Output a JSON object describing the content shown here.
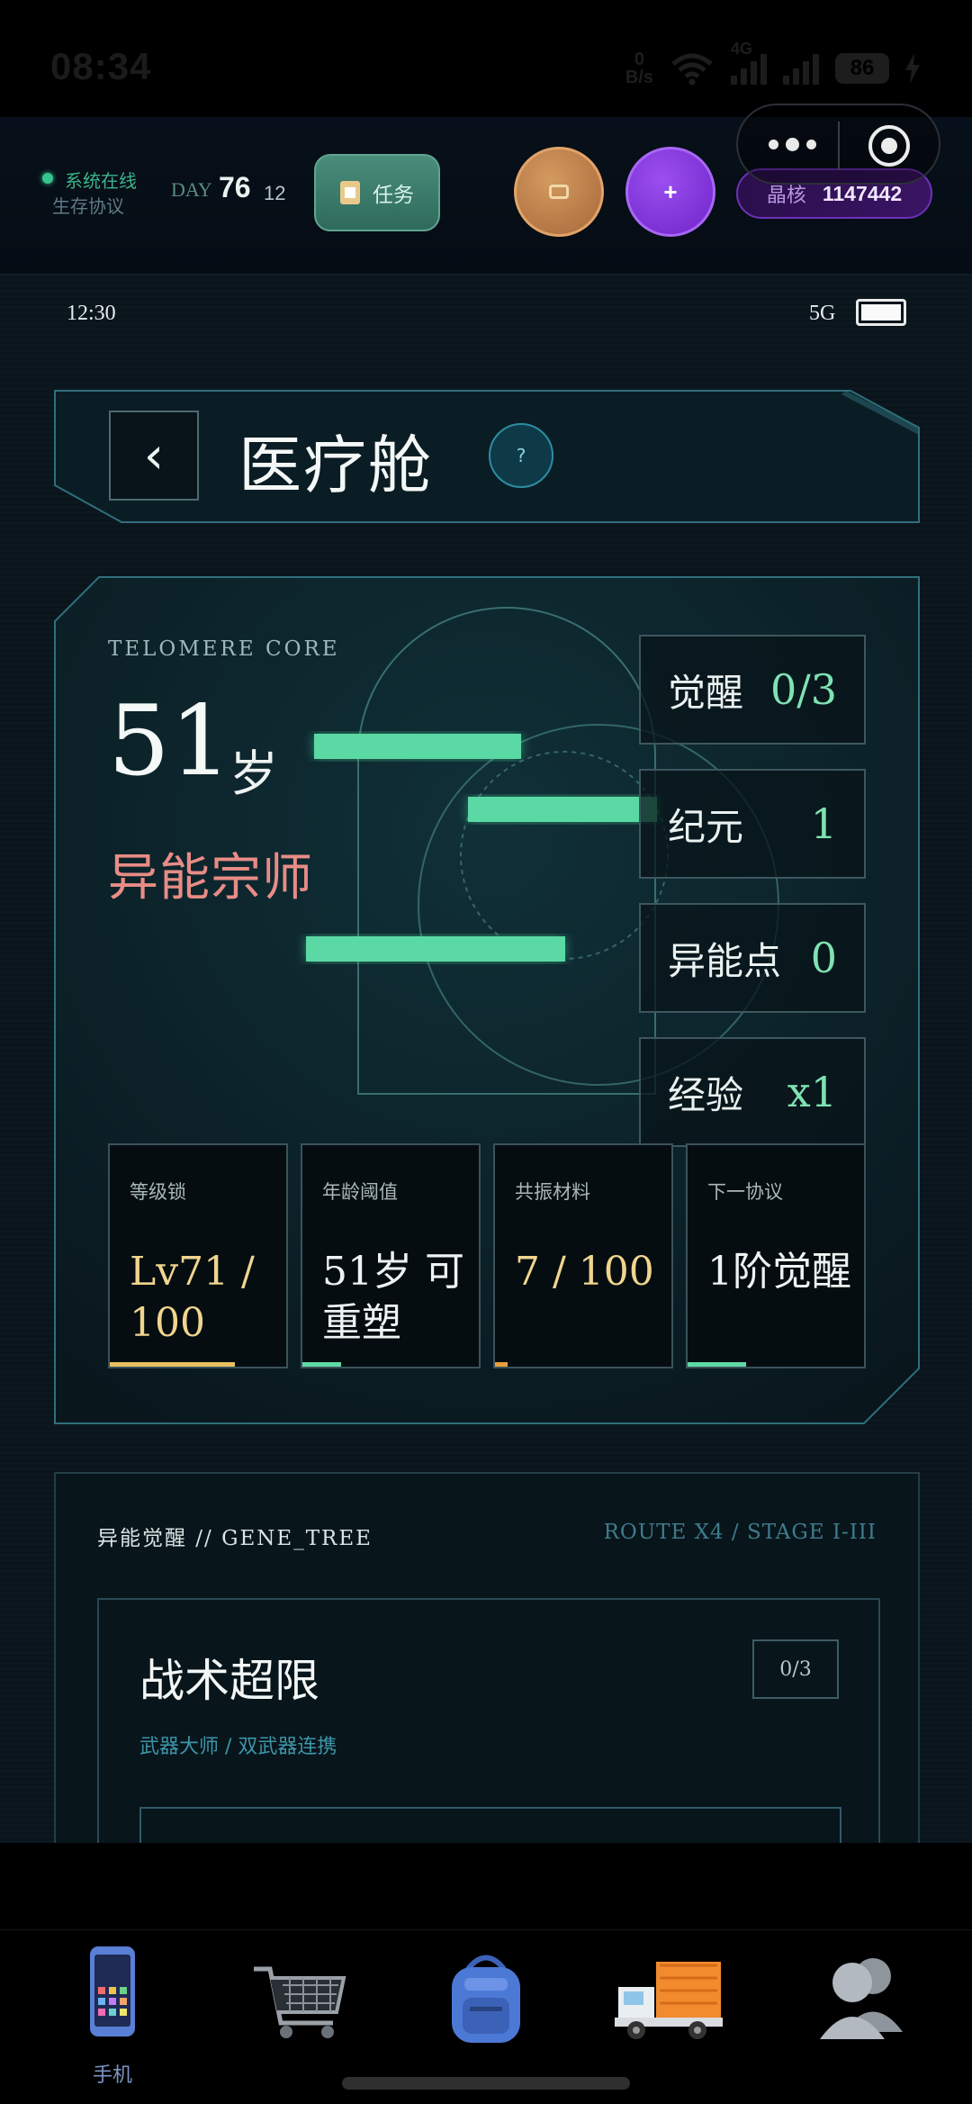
{
  "os": {
    "time": "08:34",
    "net_speed_top": "0",
    "net_speed_unit": "B/s",
    "battery": "86",
    "cell": "4G"
  },
  "header": {
    "status_online": "系统在线",
    "status_protocol": "生存协议",
    "day_label": "DAY",
    "day_number": "76",
    "day_sub": "12",
    "task_label": "任务",
    "plus_label": "+",
    "crystal_label": "晶核",
    "crystal_value": "1147442"
  },
  "inner_status": {
    "time": "12:30",
    "network": "5G"
  },
  "page": {
    "title": "医疗舱",
    "help": "?"
  },
  "core": {
    "label": "TELOMERE CORE",
    "age": "51",
    "age_unit": "岁",
    "rank": "异能宗师",
    "stats": [
      {
        "key": "觉醒",
        "value": "0/3"
      },
      {
        "key": "纪元",
        "value": "1"
      },
      {
        "key": "异能点",
        "value": "0"
      },
      {
        "key": "经验",
        "value": "x1"
      }
    ],
    "metrics": [
      {
        "label": "等级锁",
        "value": "Lv71 / 100",
        "color": "#f0d58e",
        "bar_color": "#e8c061",
        "progress": 0.71
      },
      {
        "label": "年龄阈值",
        "value": "51岁 可重塑",
        "color": "#eef3f2",
        "bar_color": "#5fd9a5",
        "progress": 0.22
      },
      {
        "label": "共振材料",
        "value": "7 / 100",
        "color": "#f0d58e",
        "bar_color": "#e8a03a",
        "progress": 0.07
      },
      {
        "label": "下一协议",
        "value": "1阶觉醒",
        "color": "#eef3f2",
        "bar_color": "#5fd9a5",
        "progress": 0.33
      }
    ]
  },
  "gene": {
    "title": "异能觉醒 // GENE_TREE",
    "route": "ROUTE X4 / STAGE I-III",
    "skill": {
      "name": "战术超限",
      "count": "0/3",
      "path": "武器大师 / 双武器连携"
    }
  },
  "nav": {
    "items": [
      {
        "label": "手机",
        "icon": "phone-icon"
      },
      {
        "label": "",
        "icon": "shopping-cart-icon"
      },
      {
        "label": "",
        "icon": "backpack-icon"
      },
      {
        "label": "",
        "icon": "delivery-truck-icon"
      },
      {
        "label": "",
        "icon": "contacts-icon"
      }
    ]
  },
  "colors": {
    "accent_green": "#5fd9a5",
    "rank_red": "#e88c86",
    "crystal_purple": "#6d31b8"
  }
}
